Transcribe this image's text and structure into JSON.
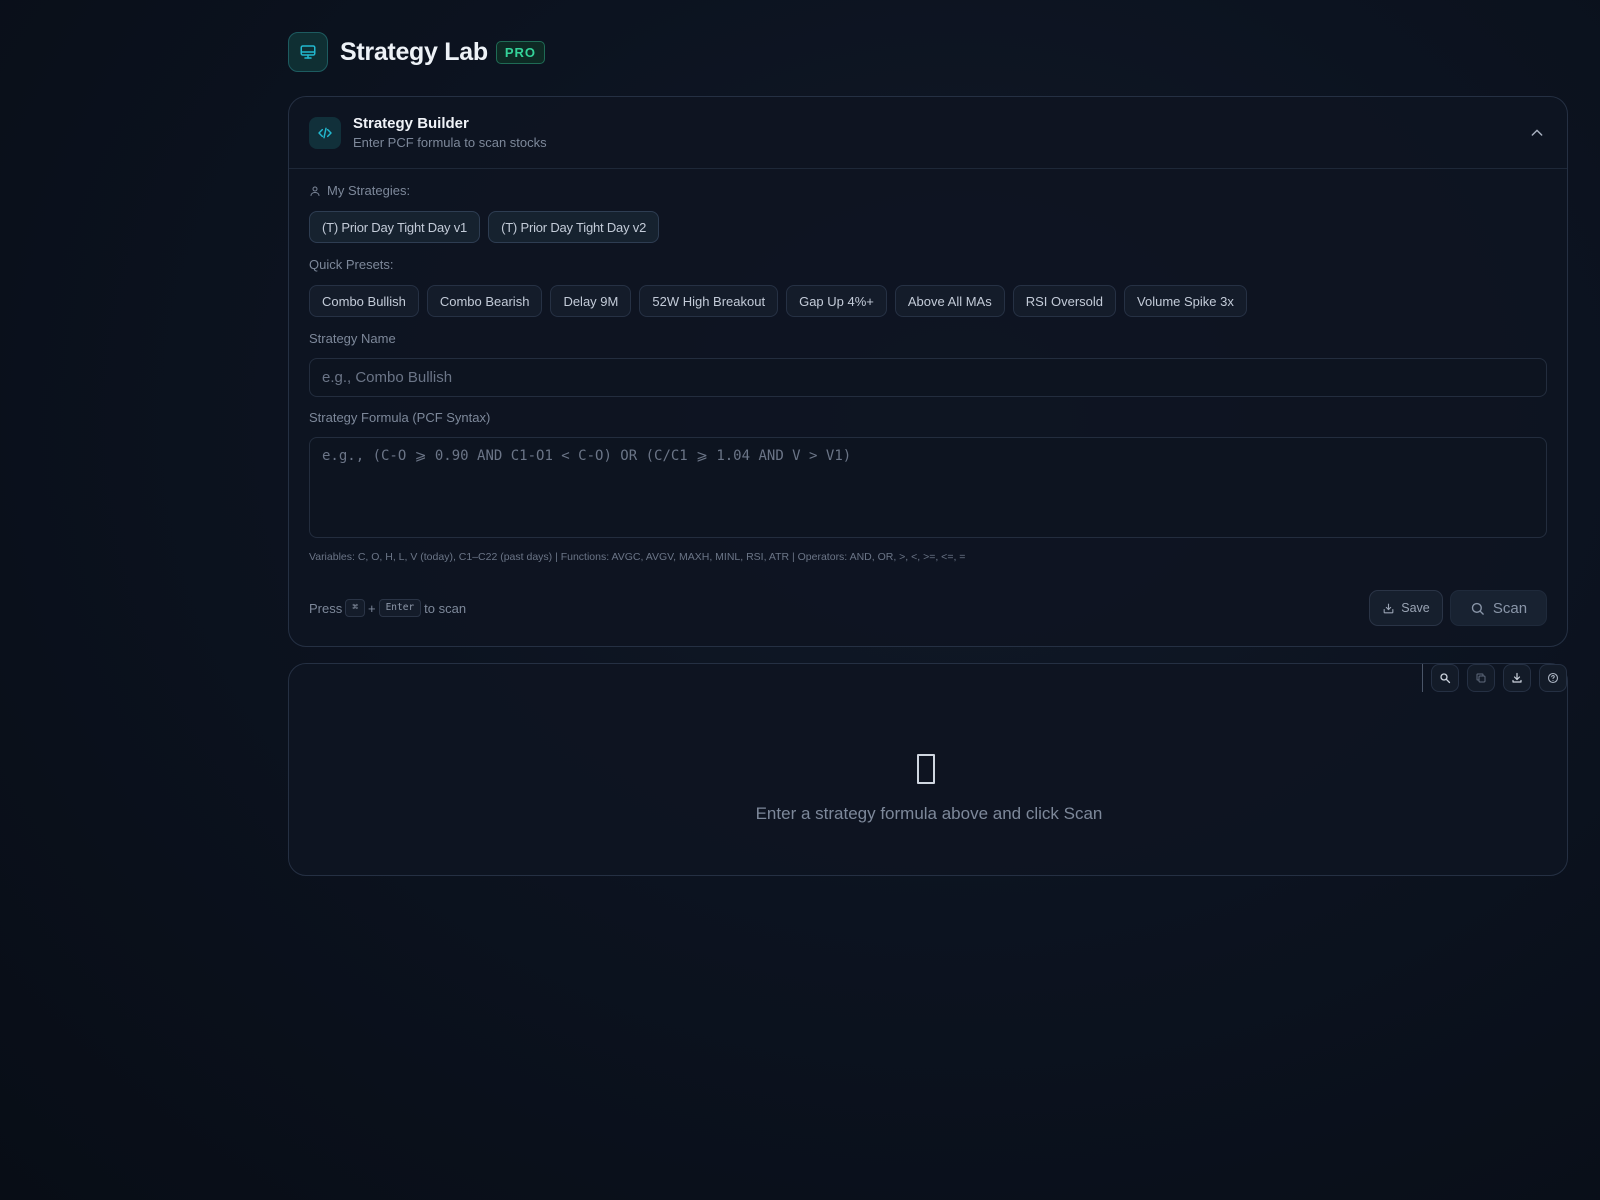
{
  "app": {
    "title": "Strategy Lab",
    "badge": "PRO",
    "accent_color": "#22b8cf",
    "badge_color": "#34d399"
  },
  "builder": {
    "title": "Strategy Builder",
    "subtitle": "Enter PCF formula to scan stocks",
    "my_strategies_label": "My Strategies:",
    "my_strategies": [
      "(T) Prior Day Tight Day v1",
      "(T) Prior Day Tight Day v2"
    ],
    "quick_presets_label": "Quick Presets:",
    "quick_presets": [
      "Combo Bullish",
      "Combo Bearish",
      "Delay 9M",
      "52W High Breakout",
      "Gap Up 4%+",
      "Above All MAs",
      "RSI Oversold",
      "Volume Spike 3x"
    ],
    "name_label": "Strategy Name",
    "name_placeholder": "e.g., Combo Bullish",
    "name_value": "",
    "formula_label": "Strategy Formula (PCF Syntax)",
    "formula_placeholder": "e.g., (C-O ⩾ 0.90 AND C1-O1 < C-O) OR (C/C1 ⩾ 1.04 AND V > V1)",
    "formula_value": "",
    "help_text": "Variables: C, O, H, L, V (today), C1–C22 (past days) | Functions: AVGC, AVGV, MAXH, MINL, RSI, ATR | Operators: AND, OR, >, <, >=, <=, =",
    "shortcut_prefix": "Press",
    "shortcut_key1": "⌘",
    "shortcut_plus": "+",
    "shortcut_key2": "Enter",
    "shortcut_suffix": "to scan",
    "save_label": "Save",
    "scan_label": "Scan"
  },
  "results": {
    "empty_message": "Enter a strategy formula above and click Scan",
    "toolbar_icons": [
      "search-icon",
      "copy-icon",
      "download-icon",
      "help-icon"
    ]
  }
}
